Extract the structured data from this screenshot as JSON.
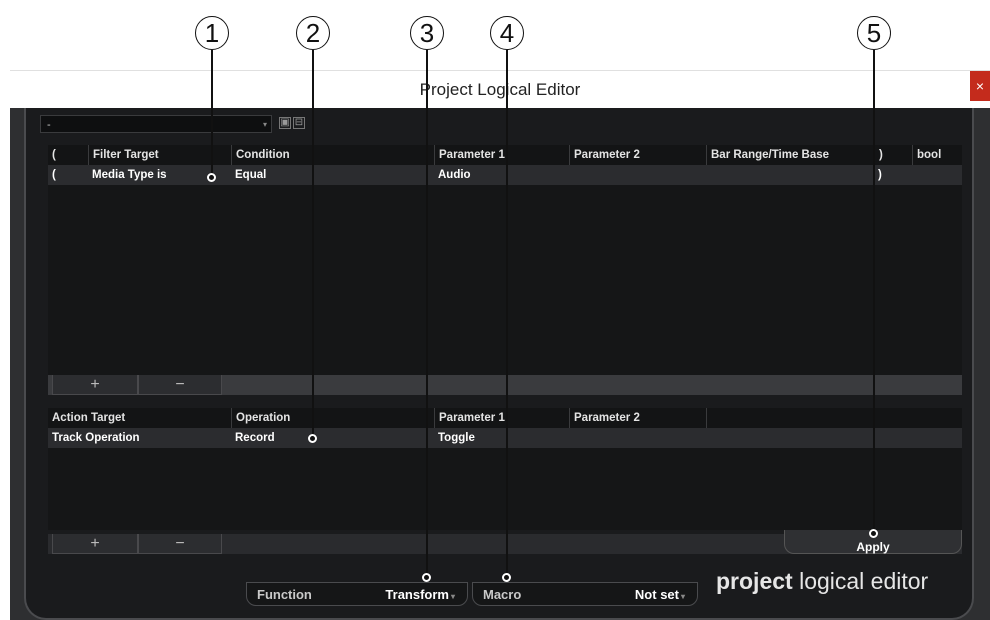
{
  "window": {
    "title": "Project Logical Editor",
    "close_label": "×"
  },
  "callouts": [
    "1",
    "2",
    "3",
    "4",
    "5"
  ],
  "preset": {
    "value": "-",
    "arrow": "▾",
    "store_icon": "▣",
    "remove_icon": "⊟"
  },
  "filter": {
    "columns": [
      "(",
      "Filter Target",
      "Condition",
      "Parameter 1",
      "Parameter 2",
      "Bar Range/Time Base",
      ")",
      "bool"
    ],
    "rows": [
      {
        "open": "(",
        "target": "Media Type is",
        "condition": "Equal",
        "param1": "Audio",
        "param2": "",
        "bar": "",
        "close": ")",
        "bool": ""
      }
    ],
    "add_label": "+",
    "remove_label": "−"
  },
  "action": {
    "columns": [
      "Action Target",
      "Operation",
      "Parameter 1",
      "Parameter 2"
    ],
    "rows": [
      {
        "target": "Track Operation",
        "operation": "Record",
        "param1": "Toggle",
        "param2": ""
      }
    ],
    "add_label": "+",
    "remove_label": "−",
    "apply_label": "Apply"
  },
  "footer": {
    "function_label": "Function",
    "function_value": "Transform",
    "macro_label": "Macro",
    "macro_value": "Not set",
    "dropdown_arrow": "▾",
    "brand_bold": "project",
    "brand_rest": " logical editor"
  },
  "colors": {
    "background": "#1a1b1d",
    "row_highlight": "#2b2c2f",
    "close_red": "#c42b1c"
  }
}
